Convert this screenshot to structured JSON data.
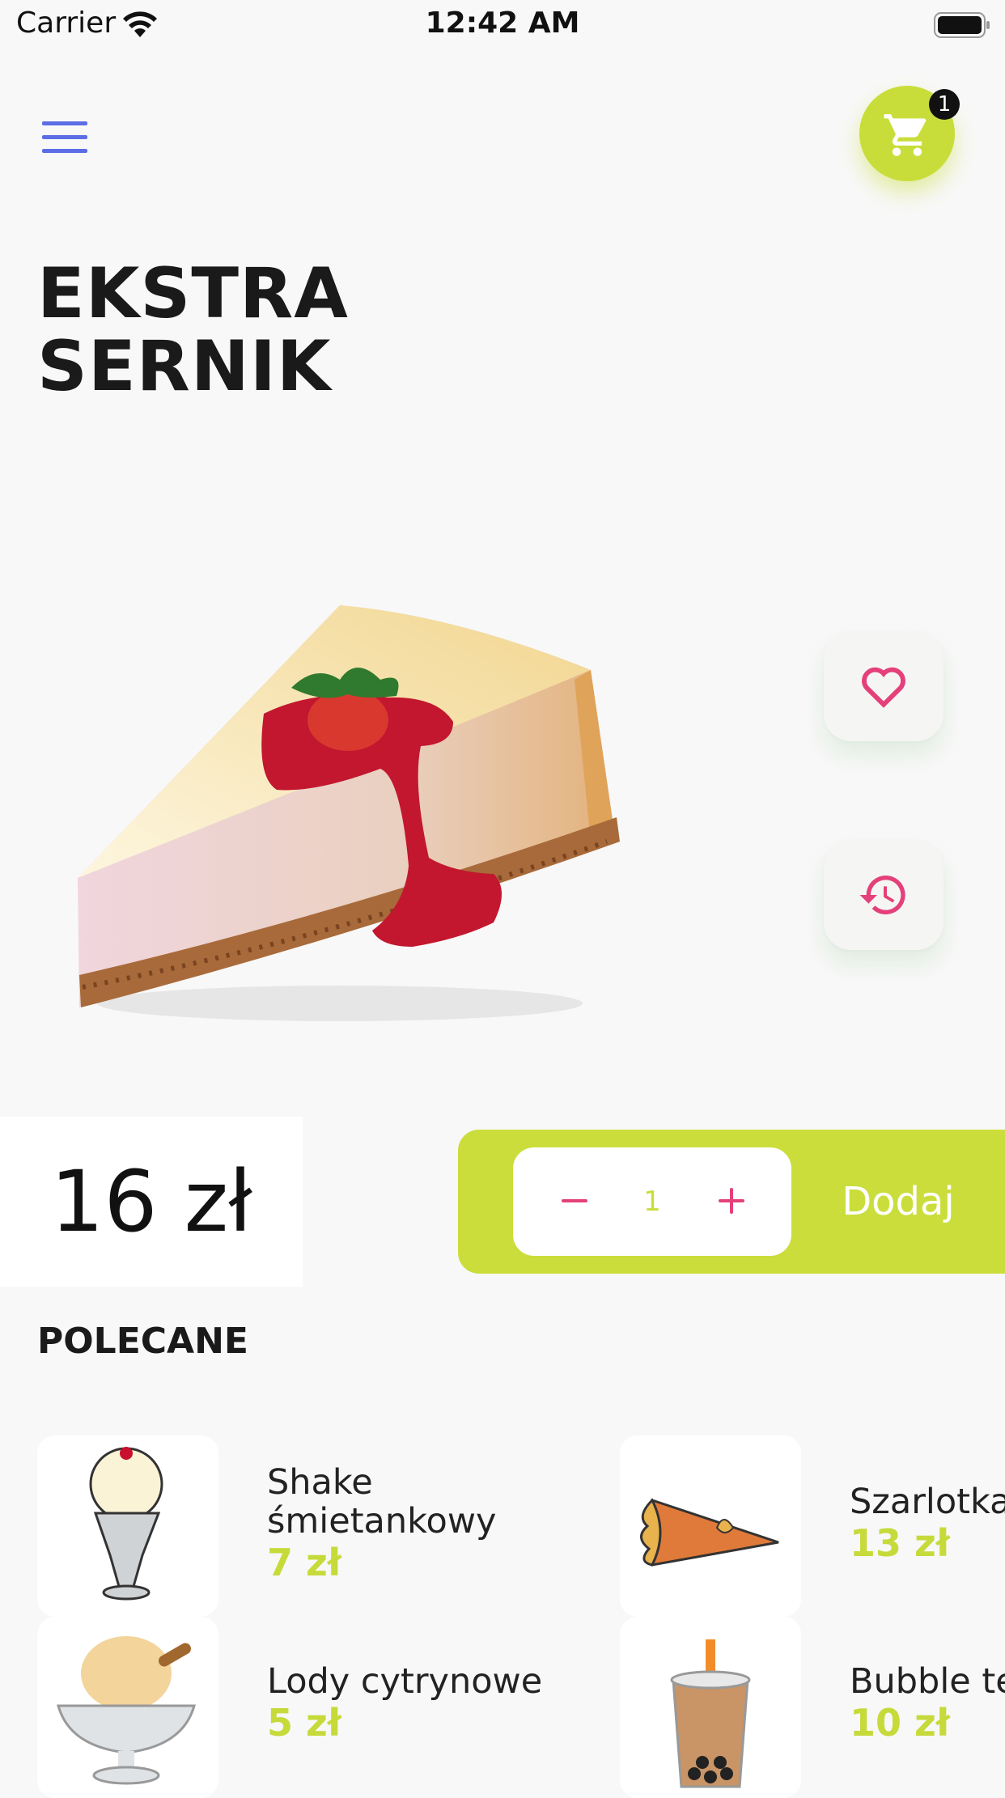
{
  "status_bar": {
    "carrier": "Carrier",
    "time": "12:42 AM"
  },
  "header": {
    "menu_icon": "hamburger-menu-icon",
    "cart_icon": "shopping-cart-icon",
    "cart_count": "1",
    "accent_color": "#c9dd3a"
  },
  "product": {
    "title_line1": "EKSTRA",
    "title_line2": "SERNIK",
    "price": "16 zł",
    "quantity": "1",
    "add_label": "Dodaj"
  },
  "actions": {
    "favorite_icon": "heart-icon",
    "history_icon": "history-icon",
    "icon_color": "#e4407a"
  },
  "recommended": {
    "title": "POLECANE",
    "items": [
      {
        "name_line1": "Shake",
        "name_line2": "śmietankowy",
        "price": "7 zł",
        "icon": "milkshake-icon"
      },
      {
        "name_line1": "Szarlotka",
        "name_line2": "",
        "price": "13 zł",
        "icon": "apple-pie-icon"
      },
      {
        "name_line1": "Lody cytrynowe",
        "name_line2": "",
        "price": "5 zł",
        "icon": "ice-cream-icon"
      },
      {
        "name_line1": "Bubble tea",
        "name_line2": "",
        "price": "10 zł",
        "icon": "bubble-tea-icon"
      }
    ]
  }
}
